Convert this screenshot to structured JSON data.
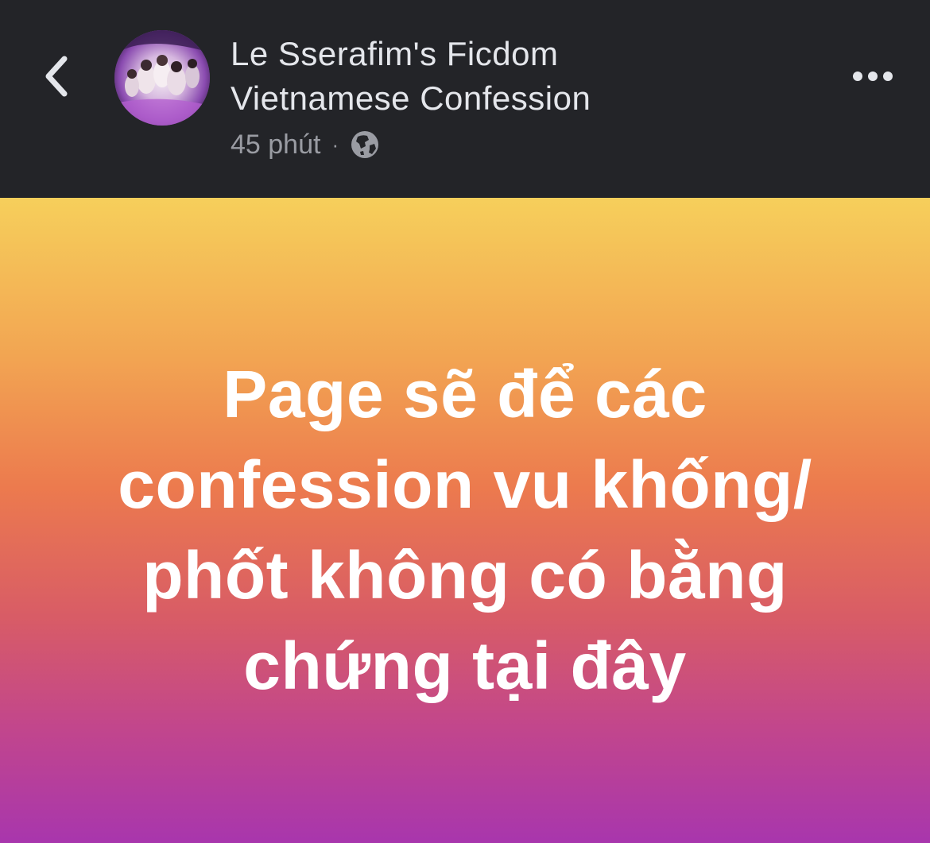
{
  "header": {
    "page_name_line1": "Le Sserafim's Ficdom",
    "page_name_line2": "Vietnamese Confession",
    "time": "45 phút",
    "separator": "·",
    "privacy_icon": "globe-icon",
    "back_icon": "chevron-left-icon",
    "more_icon": "more-horizontal-icon"
  },
  "post": {
    "lines": [
      "Page sẽ để các",
      "confession vu khống/",
      "phốt không có bằng",
      "chứng tại đây"
    ]
  },
  "colors": {
    "header_bg": "#232428",
    "header_text": "#e4e6eb",
    "meta_text": "#9a9ca3",
    "gradient_top": "#f6cf5b",
    "gradient_mid": "#ec7a4e",
    "gradient_bottom": "#a836ad",
    "post_text": "#ffffff"
  }
}
